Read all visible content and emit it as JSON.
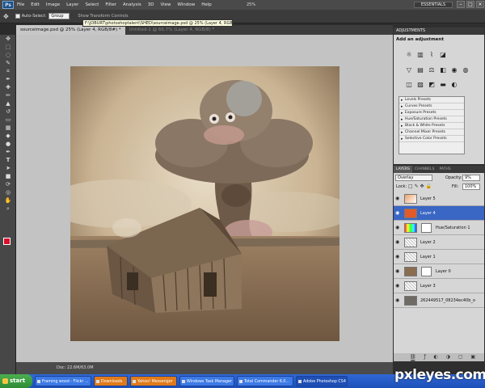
{
  "app": {
    "logo_text": "Ps",
    "essentials": "ESSENTIALS"
  },
  "menu": [
    "File",
    "Edit",
    "Image",
    "Layer",
    "Select",
    "Filter",
    "Analysis",
    "3D",
    "View",
    "Window",
    "Help"
  ],
  "zoom_readout": "25%",
  "options": {
    "auto_select_label": "Auto-Select:",
    "auto_select_value": "Group",
    "show_transform": "Show Transform Controls"
  },
  "tooltip": "F:\\JOBURT\\photoshoptalent\\SHED\\sourceimage.psd @ 25% (Layer 4, RGB/8#) *",
  "tabs": [
    "sourceimage.psd @ 25% (Layer 4, RGB/8#) *",
    "Untitled-1 @ 66.7% (Layer 4, RGB/8) *"
  ],
  "status": {
    "doc": "Doc: 22.6M/63.0M"
  },
  "adjustments": {
    "tab": "ADJUSTMENTS",
    "title": "Add an adjustment",
    "presets": [
      "Levels Presets",
      "Curves Presets",
      "Exposure Presets",
      "Hue/Saturation Presets",
      "Black & White Presets",
      "Channel Mixer Presets",
      "Selective Color Presets"
    ]
  },
  "layers_panel": {
    "tabs": [
      "LAYERS",
      "CHANNELS",
      "PATHS"
    ],
    "blend_mode": "Overlay",
    "opacity_label": "Opacity:",
    "opacity": "9%",
    "lock_label": "Lock:",
    "fill_label": "Fill:",
    "fill": "100%",
    "layers": [
      {
        "name": "Layer 5",
        "selected": false,
        "mask": false
      },
      {
        "name": "Layer 4",
        "selected": true,
        "mask": false
      },
      {
        "name": "Hue/Saturation 1",
        "selected": false,
        "mask": true
      },
      {
        "name": "Layer 2",
        "selected": false,
        "mask": false
      },
      {
        "name": "Layer 1",
        "selected": false,
        "mask": false
      },
      {
        "name": "Layer 0",
        "selected": false,
        "mask": true
      },
      {
        "name": "Layer 3",
        "selected": false,
        "mask": false
      },
      {
        "name": "262449517_08234ec40b_o",
        "selected": false,
        "mask": false
      }
    ]
  },
  "taskbar": {
    "start": "start",
    "tasks": [
      "Framing wood - Flickr ...",
      "Downloads",
      "Yahoo! Messenger",
      "Windows Task Manager",
      "Total Commander 6.0...",
      "Adobe Photoshop CS4"
    ]
  },
  "watermark": "pxleyes.com",
  "colors": {
    "foreground": "#d8102c",
    "background": "#ffffff",
    "selection": "#3a66c4"
  }
}
